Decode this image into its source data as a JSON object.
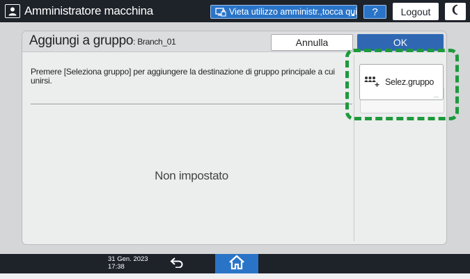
{
  "topbar": {
    "admin_title": "Amministratore macchina",
    "user_icon": "user-icon",
    "prohibit_label": "Vieta utilizzo amministr.,tocca qui",
    "prohibit_icon": "screen-lock-icon",
    "help_label": "?",
    "logout_label": "Logout",
    "night_icon": "moon-icon"
  },
  "dialog": {
    "title": "Aggiungi a gruppo",
    "subtitle": ": Branch_01",
    "cancel_label": "Annulla",
    "ok_label": "OK",
    "instruction": "Premere [Seleziona gruppo] per aggiungere la destinazione di gruppo principale a cui unirsi.",
    "empty_state": "Non impostato",
    "select_group_label": "Selez.gruppo",
    "select_group_icon": "add-group-icon",
    "select_group_more": "..."
  },
  "bottombar": {
    "date": "31 Gen. 2023",
    "time": "17:38",
    "back_icon": "back-arrow-icon",
    "home_icon": "home-icon"
  },
  "colors": {
    "topbar_bg": "#1e2229",
    "accent_blue": "#2a74c8",
    "ok_blue": "#2f67b3",
    "highlight_green": "#1d9a3c",
    "panel_bg": "#d5d6d8"
  }
}
